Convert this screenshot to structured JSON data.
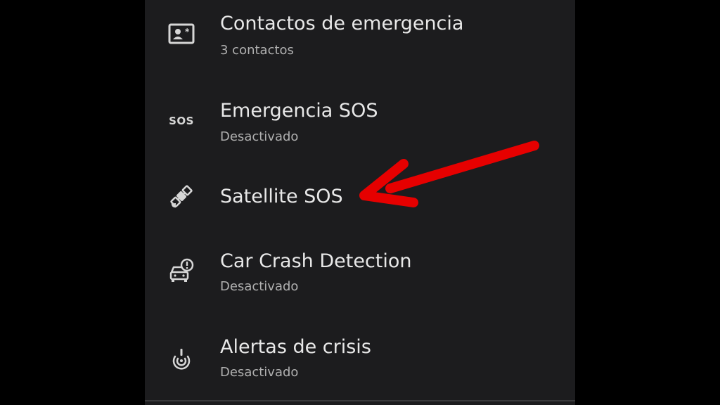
{
  "safety_settings": {
    "items": [
      {
        "title": "Contactos de emergencia",
        "subtitle": "3 contactos",
        "icon": "contact-card-icon"
      },
      {
        "title": "Emergencia SOS",
        "subtitle": "Desactivado",
        "icon": "sos-icon",
        "icon_text": "SOS"
      },
      {
        "title": "Satellite SOS",
        "subtitle": "",
        "icon": "satellite-icon"
      },
      {
        "title": "Car Crash Detection",
        "subtitle": "Desactivado",
        "icon": "car-crash-icon"
      },
      {
        "title": "Alertas de crisis",
        "subtitle": "Desactivado",
        "icon": "crisis-alert-icon"
      }
    ]
  },
  "annotation": {
    "arrow_color": "#e60000",
    "points_to": "Satellite SOS"
  },
  "colors": {
    "background": "#1c1c1e",
    "title_text": "#e8e8e8",
    "subtitle_text": "#b0b0b0",
    "icon": "#d6d6d6"
  }
}
